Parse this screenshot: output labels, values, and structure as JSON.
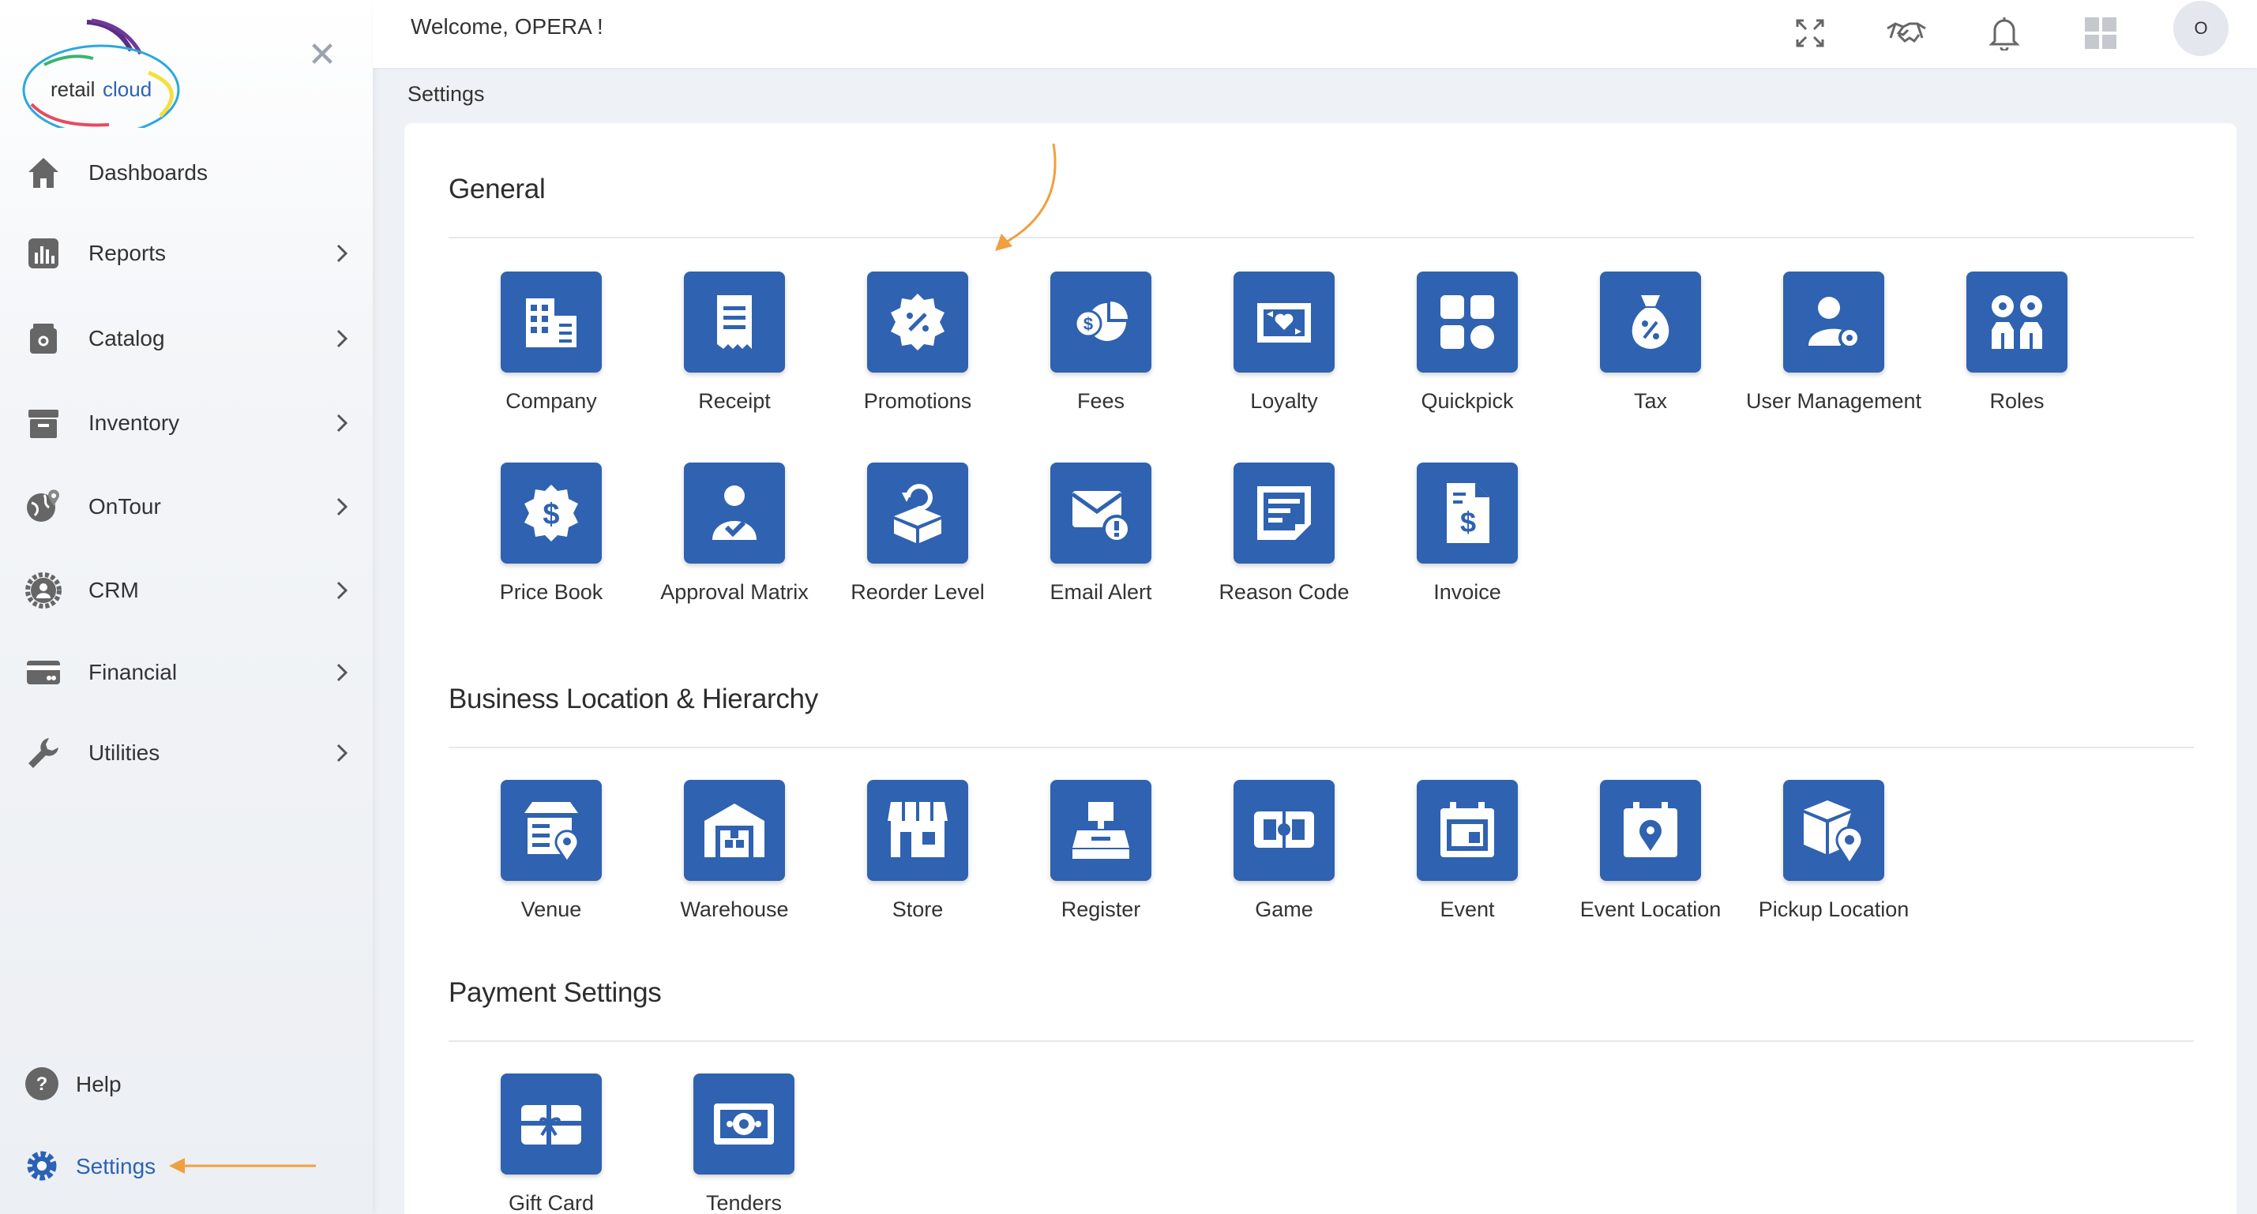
{
  "brand": {
    "logo_text_left": "retail",
    "logo_text_right": "cloud"
  },
  "sidebar": {
    "items": [
      {
        "label": "Dashboards",
        "icon": "home-icon",
        "chevron": false
      },
      {
        "label": "Reports",
        "icon": "bar-chart-icon",
        "chevron": true
      },
      {
        "label": "Catalog",
        "icon": "catalog-icon",
        "chevron": true
      },
      {
        "label": "Inventory",
        "icon": "archive-box-icon",
        "chevron": true
      },
      {
        "label": "OnTour",
        "icon": "globe-pin-icon",
        "chevron": true
      },
      {
        "label": "CRM",
        "icon": "user-circle-icon",
        "chevron": true
      },
      {
        "label": "Financial",
        "icon": "credit-card-icon",
        "chevron": true
      },
      {
        "label": "Utilities",
        "icon": "wrench-icon",
        "chevron": true
      }
    ],
    "bottom": {
      "help_label": "Help",
      "settings_label": "Settings"
    }
  },
  "header": {
    "welcome": "Welcome, OPERA !",
    "avatar_initial": "O"
  },
  "breadcrumb": "Settings",
  "sections": {
    "general": {
      "title": "General",
      "tiles": [
        "Company",
        "Receipt",
        "Promotions",
        "Fees",
        "Loyalty",
        "Quickpick",
        "Tax",
        "User Management",
        "Roles",
        "Price Book",
        "Approval Matrix",
        "Reorder Level",
        "Email Alert",
        "Reason Code",
        "Invoice"
      ]
    },
    "business": {
      "title": "Business Location & Hierarchy",
      "tiles": [
        "Venue",
        "Warehouse",
        "Store",
        "Register",
        "Game",
        "Event",
        "Event Location",
        "Pickup Location"
      ]
    },
    "payment": {
      "title": "Payment Settings",
      "tiles": [
        "Gift Card",
        "Tenders"
      ]
    }
  },
  "colors": {
    "tile_blue": "#2f62b0",
    "accent_orange": "#f0a040",
    "active_blue": "#2c62b4",
    "notification_red": "#e53950"
  }
}
